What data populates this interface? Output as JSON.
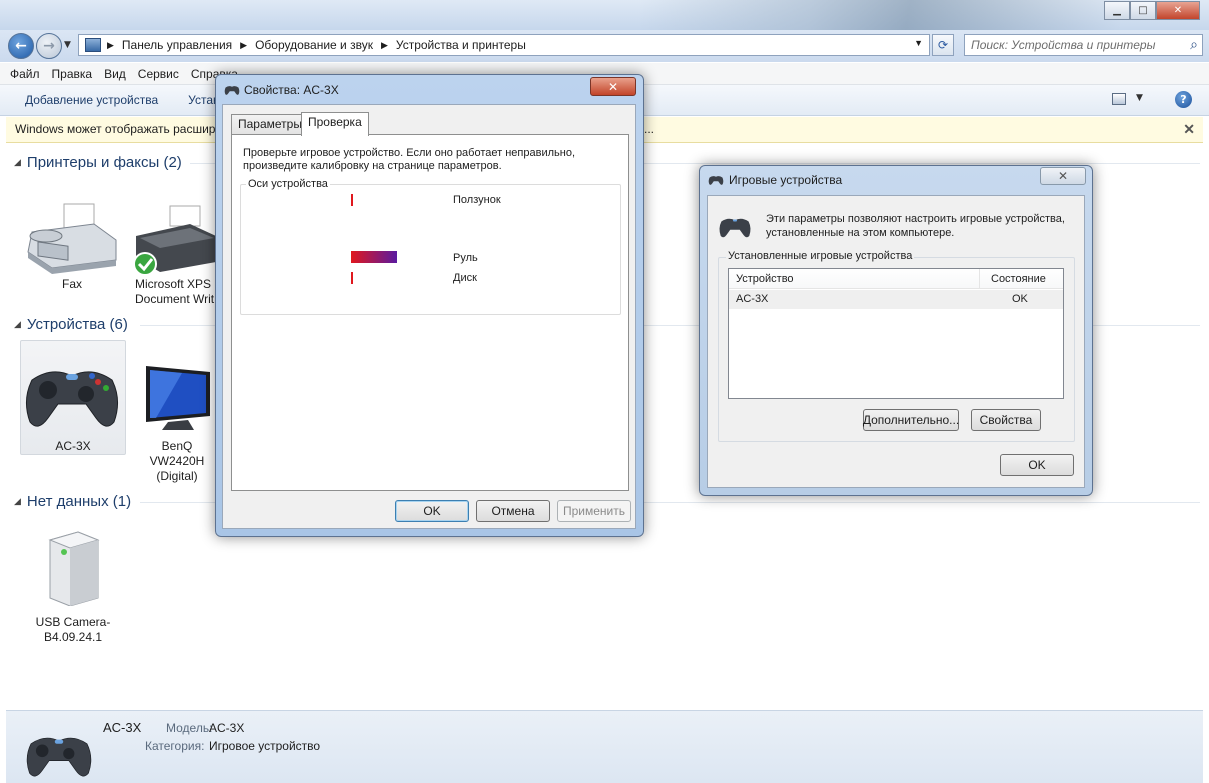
{
  "window": {
    "minimize_glyph": "▁",
    "maximize_glyph": "□",
    "close_glyph": "✕"
  },
  "nav": {
    "back_glyph": "←",
    "forward_glyph": "→",
    "dropdown_glyph": "▼",
    "breadcrumbs": [
      "Панель управления",
      "Оборудование и звук",
      "Устройства и принтеры"
    ],
    "crumb_sep": "▶",
    "refresh_glyph": "⟳",
    "search_placeholder": "Поиск: Устройства и принтеры",
    "search_icon": "magnifier-icon"
  },
  "menu": {
    "items": [
      "Файл",
      "Правка",
      "Вид",
      "Сервис",
      "Справка"
    ]
  },
  "toolbar": {
    "add_device": "Добавление устройства",
    "add_printer_partial": "Устан",
    "help_glyph": "?"
  },
  "infobar": {
    "text": "Windows может отображать расшир",
    "ellipsis": "...",
    "close_glyph": "✕"
  },
  "groups": {
    "printers": {
      "title": "Принтеры и факсы (2)",
      "items": [
        {
          "label": "Fax"
        },
        {
          "label": "Microsoft XPS Document Writ"
        }
      ]
    },
    "devices": {
      "title": "Устройства (6)",
      "items": [
        {
          "label": "AC-3X"
        },
        {
          "label": "BenQ VW2420H (Digital)"
        }
      ]
    },
    "nodata": {
      "title": "Нет данных (1)",
      "items": [
        {
          "label": "USB Camera-B4.09.24.1"
        }
      ]
    }
  },
  "details": {
    "name": "AC-3X",
    "model_label": "Модель:",
    "model_value": "AC-3X",
    "category_label": "Категория:",
    "category_value": "Игровое устройство"
  },
  "props_dialog": {
    "title": "Свойства: AC-3X",
    "close_glyph": "✕",
    "tabs": [
      "Параметры",
      "Проверка"
    ],
    "active_tab": "Проверка",
    "instruction": "Проверьте игровое устройство. Если оно работает неправильно, произведите калибровку на странице параметров.",
    "axes_group": "Оси устройства",
    "axes": [
      {
        "label": "Ползунок",
        "fill": 0.0
      },
      {
        "label": "Руль",
        "fill": 1.0
      },
      {
        "label": "Диск",
        "fill": 0.0
      }
    ],
    "axis_color_start": "#e0181e",
    "axis_color_end": "#5a1aa0",
    "ok": "OK",
    "cancel": "Отмена",
    "apply": "Применить"
  },
  "game_dialog": {
    "title": "Игровые устройства",
    "close_glyph": "✕",
    "description": "Эти параметры позволяют настроить игровые устройства, установленные на этом компьютере.",
    "list_group": "Установленные игровые устройства",
    "columns": [
      "Устройство",
      "Состояние"
    ],
    "rows": [
      {
        "device": "AC-3X",
        "state": "OK"
      }
    ],
    "advanced": "Дополнительно...",
    "properties": "Свойства",
    "ok": "OK"
  }
}
